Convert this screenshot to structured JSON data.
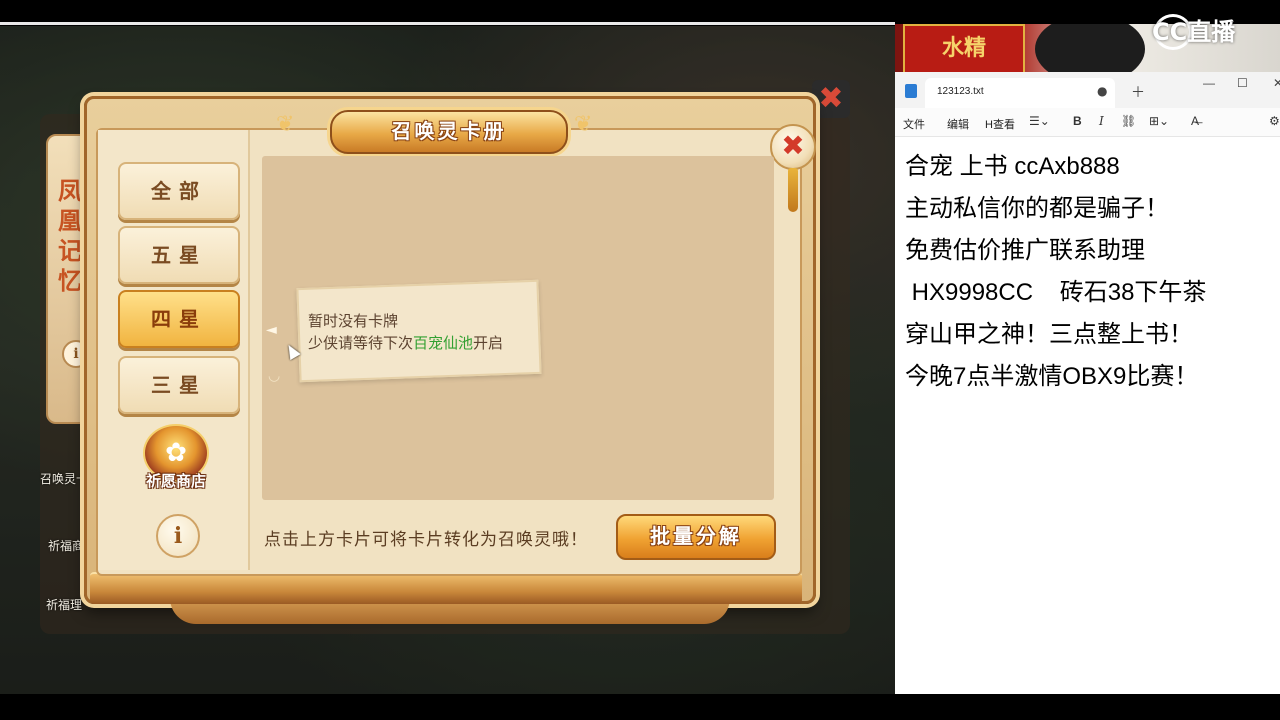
{
  "game": {
    "panel_title": "召唤灵卡册",
    "close_symbol": "✖",
    "back_close_symbol": "✖",
    "tabs": [
      {
        "label": "全部",
        "active": false
      },
      {
        "label": "五星",
        "active": false
      },
      {
        "label": "四星",
        "active": true
      },
      {
        "label": "三星",
        "active": false
      }
    ],
    "shop_label": "祈愿商店",
    "info_symbol": "i",
    "empty_line1": "暂时没有卡牌",
    "empty_line2_before": "少侠请等待下次",
    "empty_line2_highlight": "百宠仙池",
    "empty_line2_after": "开启",
    "hint": "点击上方卡片可将卡片转化为召唤灵哦！",
    "batch_button": "批量分解",
    "left_panel_title": "凤凰记忆",
    "left_items": [
      "召唤灵卡",
      "祈福商",
      "祈福理"
    ],
    "colors": {
      "highlight_green": "#32a032",
      "active_tab": "#f1b440",
      "panel_bg": "#f1e2c2"
    }
  },
  "stream": {
    "logo_text": "CC直播",
    "cam_banner": "水精"
  },
  "notepad": {
    "file_name": "123123.txt",
    "menus": [
      "文件",
      "编辑",
      "H查看"
    ],
    "toolbar": {
      "bold": "B",
      "italic": "I"
    },
    "lines": [
      "合宠 上书 ccAxb888",
      "主动私信你的都是骗子！",
      "免费估价推广联系助理",
      " HX9998CC    砖石38下午茶",
      "穿山甲之神！三点整上书！",
      "今晚7点半激情OBX9比赛！"
    ]
  }
}
